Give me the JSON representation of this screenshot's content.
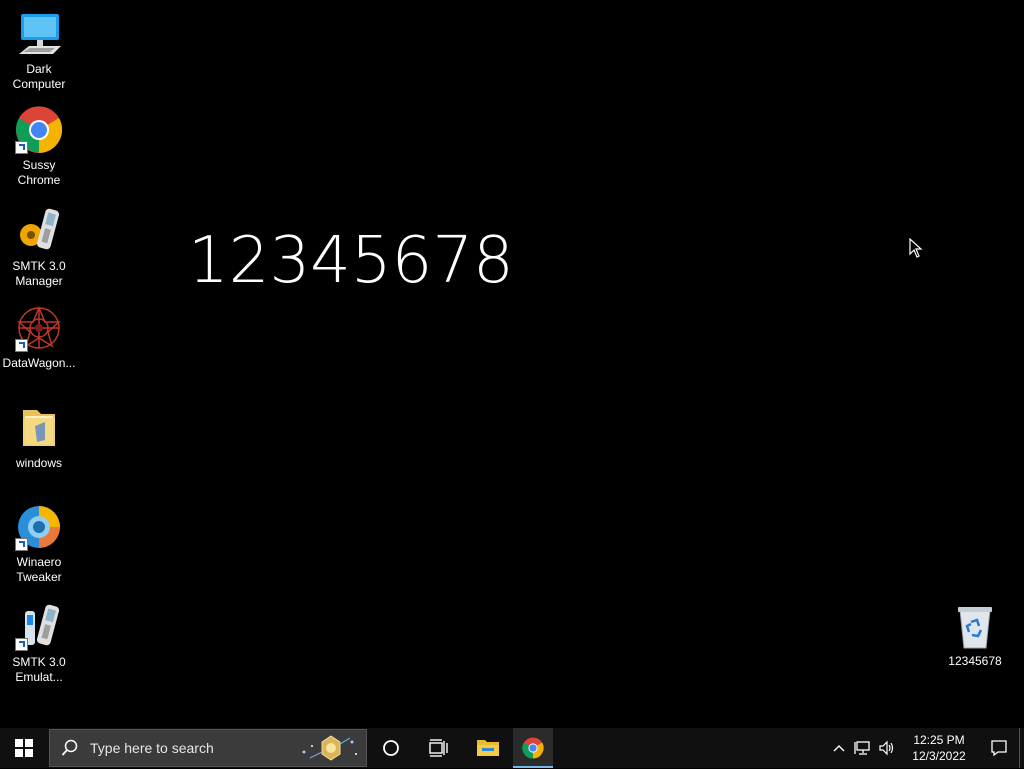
{
  "desktop": {
    "icons": [
      {
        "label": "Dark Computer",
        "icon": "computer-icon"
      },
      {
        "label": "Sussy Chrome",
        "icon": "chrome-icon"
      },
      {
        "label": "SMTK 3.0 Manager",
        "icon": "smtk-manager-icon"
      },
      {
        "label": "DataWagon...",
        "icon": "datawagon-icon"
      },
      {
        "label": "windows",
        "icon": "folder-icon"
      },
      {
        "label": "Winaero Tweaker",
        "icon": "winaero-icon"
      },
      {
        "label": "SMTK 3.0 Emulat...",
        "icon": "smtk-emulator-icon"
      }
    ],
    "recycle_bin": {
      "label": "12345678",
      "icon": "recycle-bin-icon"
    },
    "big_text": "12345678"
  },
  "taskbar": {
    "search_placeholder": "Type here to search",
    "clock_time": "12:25 PM",
    "clock_date": "12/3/2022"
  },
  "colors": {
    "background": "#000000",
    "taskbar": "#101010",
    "active_indicator": "#76b9ed"
  }
}
